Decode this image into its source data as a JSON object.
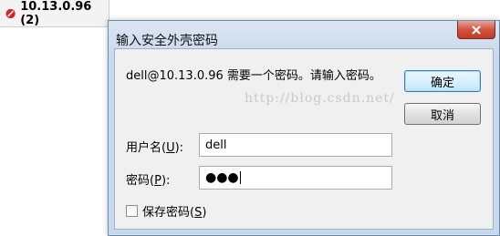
{
  "background_tab": {
    "title": "10.13.0.96 (2)"
  },
  "dialog": {
    "title": "输入安全外壳密码",
    "message": "dell@10.13.0.96 需要一个密码。请输入密码。",
    "watermark": "http://blog.csdn.net/",
    "ok_label": "确定",
    "cancel_label": "取消",
    "username_label": "用户名",
    "username_accel": "U",
    "username_value": "dell",
    "password_label": "密码",
    "password_accel": "P",
    "password_value": "●●●",
    "save_password_label": "保存密码",
    "save_password_accel": "S",
    "save_password_checked": false
  },
  "colors": {
    "close_button": "#d3533d",
    "titlebar": "#c9d9ec"
  }
}
